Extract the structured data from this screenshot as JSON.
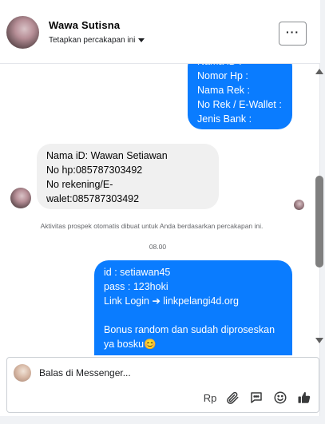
{
  "conversation": {
    "contact_name": "Wawa Sutisna",
    "subtitle": "Tetapkan percakapan ini",
    "more_label": "···"
  },
  "messages": [
    {
      "direction": "outgoing",
      "text": "Nama iD :\nNomor Hp :\nNama Rek :\nNo Rek / E-Wallet :\nJenis Bank :"
    },
    {
      "direction": "incoming",
      "text": "Nama iD: Wawan Setiawan\nNo hp:085787303492\nNo rekening/E-\nwalet:085787303492"
    },
    {
      "direction": "outgoing",
      "text": "id : setiawan45\npass : 123hoki\nLink Login ➔ linkpelangi4d.org\n\nBonus random dan sudah diproseskan ya bosku😊"
    }
  ],
  "system_note": "Aktivitas prospek otomatis dibuat untuk Anda berdasarkan percakapan ini.",
  "timestamp": "08.00",
  "composer": {
    "placeholder": "Balas di Messenger...",
    "currency_label": "Rp"
  },
  "icons": {
    "attachment": "paperclip-icon",
    "saved_replies": "speech-bubble-icon",
    "emoji": "smiley-icon",
    "like": "thumbs-up-icon"
  },
  "colors": {
    "outgoing_bubble": "#0a7cff",
    "incoming_bubble": "#f0f0f0"
  }
}
